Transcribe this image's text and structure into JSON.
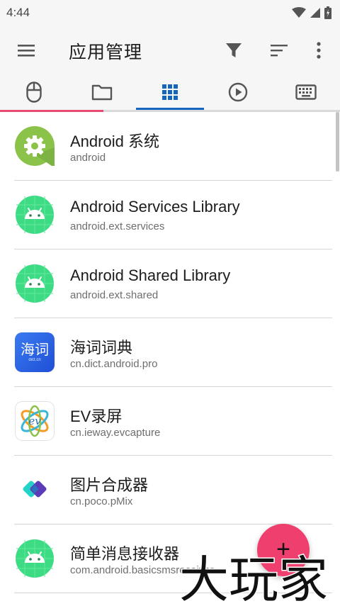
{
  "status_bar": {
    "time": "4:44"
  },
  "app_bar": {
    "title": "应用管理",
    "icons": [
      "menu-icon",
      "filter-icon",
      "sort-icon",
      "more-vert-icon"
    ]
  },
  "tabs": [
    {
      "icon": "mouse-icon"
    },
    {
      "icon": "folder-icon"
    },
    {
      "icon": "apps-grid-icon",
      "selected": true
    },
    {
      "icon": "play-circle-icon"
    },
    {
      "icon": "keyboard-icon"
    }
  ],
  "colors": {
    "accent_blue": "#1565c0",
    "fab_pink": "#ee3f6e",
    "progress_pink": "#e84a74",
    "android_green": "#3ddc84",
    "settings_green": "#8bc34a"
  },
  "apps": [
    {
      "name": "Android 系统",
      "package": "android",
      "icon": "settings-gear-icon"
    },
    {
      "name": "Android Services Library",
      "package": "android.ext.services",
      "icon": "android-robot-icon"
    },
    {
      "name": "Android Shared Library",
      "package": "android.ext.shared",
      "icon": "android-robot-icon"
    },
    {
      "name": "海词词典",
      "package": "cn.dict.android.pro",
      "icon": "haici-dict-icon",
      "icon_text": "海词",
      "icon_subtext": "dict.cn"
    },
    {
      "name": "EV录屏",
      "package": "cn.ieway.evcapture",
      "icon": "ev-capture-icon"
    },
    {
      "name": "图片合成器",
      "package": "cn.poco.pMix",
      "icon": "pmix-icon"
    },
    {
      "name": "简单消息接收器",
      "package": "com.android.basicsmsreceiver",
      "icon": "android-robot-icon"
    }
  ],
  "fab": {
    "label": "+"
  },
  "watermark": {
    "text": "大玩家"
  }
}
